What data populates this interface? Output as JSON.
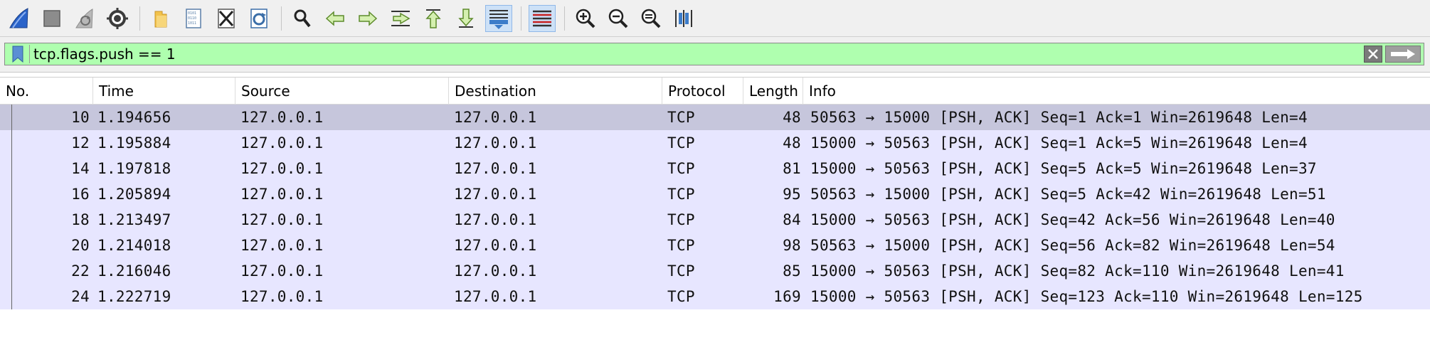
{
  "toolbar": {
    "buttons": [
      {
        "name": "start-capture-icon",
        "active": false
      },
      {
        "name": "stop-capture-icon",
        "active": false
      },
      {
        "name": "restart-capture-icon",
        "active": false
      },
      {
        "name": "capture-options-icon",
        "active": false
      },
      {
        "name": "open-file-icon",
        "active": false
      },
      {
        "name": "save-file-icon",
        "active": false
      },
      {
        "name": "close-file-icon",
        "active": false
      },
      {
        "name": "reload-file-icon",
        "active": false
      },
      {
        "name": "find-packet-icon",
        "active": false
      },
      {
        "name": "go-back-icon",
        "active": false
      },
      {
        "name": "go-forward-icon",
        "active": false
      },
      {
        "name": "go-to-packet-icon",
        "active": false
      },
      {
        "name": "first-packet-icon",
        "active": false
      },
      {
        "name": "last-packet-icon",
        "active": false
      },
      {
        "name": "auto-scroll-icon",
        "active": true
      },
      {
        "name": "colorize-icon",
        "active": true
      },
      {
        "name": "zoom-in-icon",
        "active": false
      },
      {
        "name": "zoom-out-icon",
        "active": false
      },
      {
        "name": "normal-size-icon",
        "active": false
      },
      {
        "name": "resize-columns-icon",
        "active": false
      }
    ]
  },
  "filter": {
    "value": "tcp.flags.push == 1",
    "valid_color": "#afffaf"
  },
  "columns": [
    "No.",
    "Time",
    "Source",
    "Destination",
    "Protocol",
    "Length",
    "Info"
  ],
  "packets": [
    {
      "no": "10",
      "time": "1.194656",
      "source": "127.0.0.1",
      "destination": "127.0.0.1",
      "protocol": "TCP",
      "length": "48",
      "info": "50563 → 15000 [PSH, ACK] Seq=1 Ack=1 Win=2619648 Len=4",
      "selected": true
    },
    {
      "no": "12",
      "time": "1.195884",
      "source": "127.0.0.1",
      "destination": "127.0.0.1",
      "protocol": "TCP",
      "length": "48",
      "info": "15000 → 50563 [PSH, ACK] Seq=1 Ack=5 Win=2619648 Len=4",
      "selected": false
    },
    {
      "no": "14",
      "time": "1.197818",
      "source": "127.0.0.1",
      "destination": "127.0.0.1",
      "protocol": "TCP",
      "length": "81",
      "info": "15000 → 50563 [PSH, ACK] Seq=5 Ack=5 Win=2619648 Len=37",
      "selected": false
    },
    {
      "no": "16",
      "time": "1.205894",
      "source": "127.0.0.1",
      "destination": "127.0.0.1",
      "protocol": "TCP",
      "length": "95",
      "info": "50563 → 15000 [PSH, ACK] Seq=5 Ack=42 Win=2619648 Len=51",
      "selected": false
    },
    {
      "no": "18",
      "time": "1.213497",
      "source": "127.0.0.1",
      "destination": "127.0.0.1",
      "protocol": "TCP",
      "length": "84",
      "info": "15000 → 50563 [PSH, ACK] Seq=42 Ack=56 Win=2619648 Len=40",
      "selected": false
    },
    {
      "no": "20",
      "time": "1.214018",
      "source": "127.0.0.1",
      "destination": "127.0.0.1",
      "protocol": "TCP",
      "length": "98",
      "info": "50563 → 15000 [PSH, ACK] Seq=56 Ack=82 Win=2619648 Len=54",
      "selected": false
    },
    {
      "no": "22",
      "time": "1.216046",
      "source": "127.0.0.1",
      "destination": "127.0.0.1",
      "protocol": "TCP",
      "length": "85",
      "info": "15000 → 50563 [PSH, ACK] Seq=82 Ack=110 Win=2619648 Len=41",
      "selected": false
    },
    {
      "no": "24",
      "time": "1.222719",
      "source": "127.0.0.1",
      "destination": "127.0.0.1",
      "protocol": "TCP",
      "length": "169",
      "info": "15000 → 50563 [PSH, ACK] Seq=123 Ack=110 Win=2619648 Len=125",
      "selected": false
    }
  ],
  "colors": {
    "row_bg": "#e7e6ff",
    "selected_row_bg": "#c6c6dc",
    "toolbar_bg": "#f0f0f0"
  }
}
